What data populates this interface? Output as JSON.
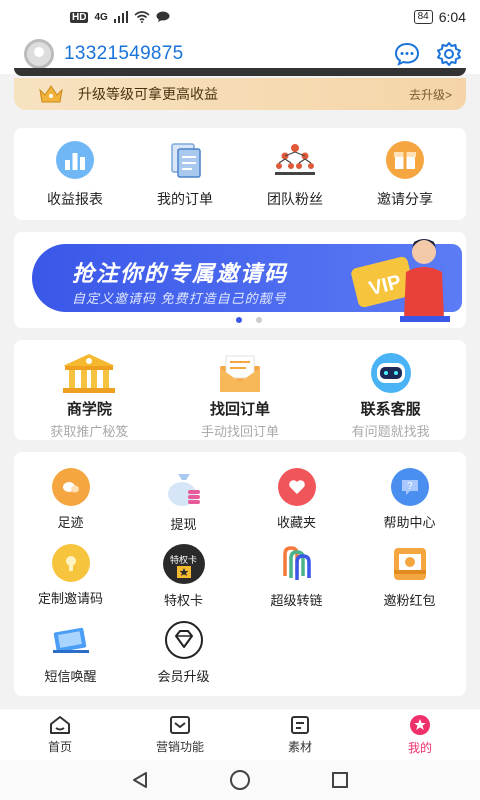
{
  "status": {
    "network": "HD",
    "signal": "4G",
    "battery": "84",
    "time": "6:04"
  },
  "header": {
    "phone": "13321549875"
  },
  "upgrade_bar": {
    "text": "升级等级可拿更高收益",
    "action": "去升级>"
  },
  "top_grid": [
    {
      "label": "收益报表",
      "icon": "chart-icon"
    },
    {
      "label": "我的订单",
      "icon": "orders-icon"
    },
    {
      "label": "团队粉丝",
      "icon": "team-icon"
    },
    {
      "label": "邀请分享",
      "icon": "gift-icon"
    }
  ],
  "banner": {
    "title": "抢注你的专属邀请码",
    "subtitle": "自定义邀请码 免费打造自己的靓号",
    "badge": "VIP"
  },
  "feature_row": [
    {
      "title": "商学院",
      "subtitle": "获取推广秘笈",
      "icon": "academy-icon"
    },
    {
      "title": "找回订单",
      "subtitle": "手动找回订单",
      "icon": "envelope-icon"
    },
    {
      "title": "联系客服",
      "subtitle": "有问题就找我",
      "icon": "robot-icon"
    }
  ],
  "service_grid": [
    {
      "label": "足迹",
      "icon": "footprint-icon",
      "color": "#f5a641"
    },
    {
      "label": "提现",
      "icon": "money-bag-icon",
      "color": "#e85a9a"
    },
    {
      "label": "收藏夹",
      "icon": "heart-icon",
      "color": "#f0555a"
    },
    {
      "label": "帮助中心",
      "icon": "help-icon",
      "color": "#4a8ef0"
    },
    {
      "label": "定制邀请码",
      "icon": "custom-code-icon",
      "color": "#f7c43e"
    },
    {
      "label": "特权卡",
      "icon": "privilege-card-icon",
      "color": "#2a2a2a",
      "badge": "特权卡"
    },
    {
      "label": "超级转链",
      "icon": "link-icon",
      "color": "#f57a3a"
    },
    {
      "label": "邀粉红包",
      "icon": "red-packet-icon",
      "color": "#f5a641"
    },
    {
      "label": "短信唤醒",
      "icon": "sms-icon",
      "color": "#4a9ef5"
    },
    {
      "label": "会员升级",
      "icon": "diamond-icon",
      "color": "#222222"
    }
  ],
  "tabbar": [
    {
      "label": "首页",
      "icon": "home-icon"
    },
    {
      "label": "营销功能",
      "icon": "marketing-icon"
    },
    {
      "label": "素材",
      "icon": "material-icon"
    },
    {
      "label": "我的",
      "icon": "profile-icon",
      "active": true
    }
  ]
}
